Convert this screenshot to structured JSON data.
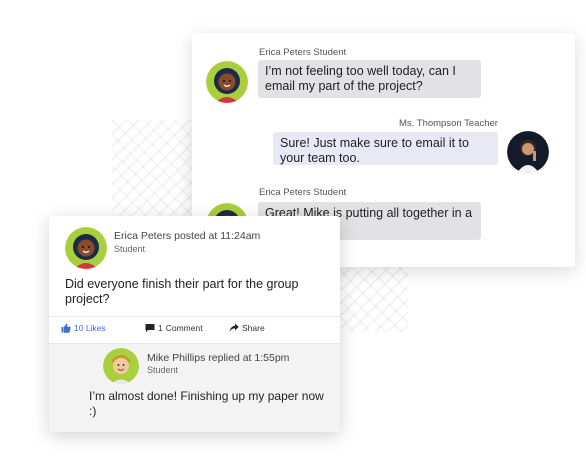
{
  "chat": {
    "messages": [
      {
        "sender": "Erica Peters Student",
        "text": "I’m not feeling too well today, can I email my part of the project?",
        "avatar_icon": "student-girl-avatar-icon"
      },
      {
        "sender": "Ms. Thompson Teacher",
        "text": "Sure! Just make sure to email it to your team too.",
        "avatar_icon": "teacher-avatar-icon"
      },
      {
        "sender": "Erica Peters Student",
        "text": "Great! Mike is putting all together in a to hand in.",
        "avatar_icon": "student-girl-avatar-icon"
      }
    ]
  },
  "post": {
    "author": "Erica Peters posted at 11:24am",
    "role": "Student",
    "text": "Did everyone finish their part for the group project?",
    "actions": {
      "likes_label": "10 Likes",
      "comment_count": "1",
      "comment_label": "Comment",
      "share_label": "Share"
    },
    "reply": {
      "author": "Mike Phillips replied at 1:55pm",
      "role": "Student",
      "text": "I’m almost done! Finishing up my paper now :)"
    }
  },
  "colors": {
    "avatar_ring": "#a9cf3c",
    "like_blue": "#3b6fc9",
    "bubble_left": "#e2e2e4",
    "bubble_right": "#e8e9f5"
  }
}
